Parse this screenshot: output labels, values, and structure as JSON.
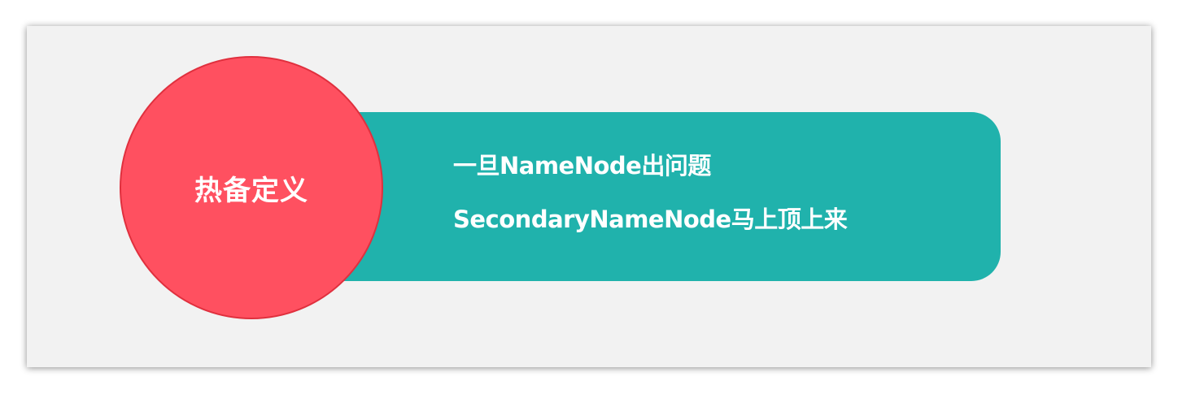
{
  "circle": {
    "title": "热备定义"
  },
  "panel": {
    "lines": [
      "一旦NameNode出问题",
      "SecondaryNameNode马上顶上来"
    ]
  },
  "colors": {
    "circle_fill": "#ff5060",
    "circle_border": "#e0303e",
    "panel_fill": "#20b2ac",
    "slide_background": "#f2f2f2",
    "text": "#ffffff"
  }
}
